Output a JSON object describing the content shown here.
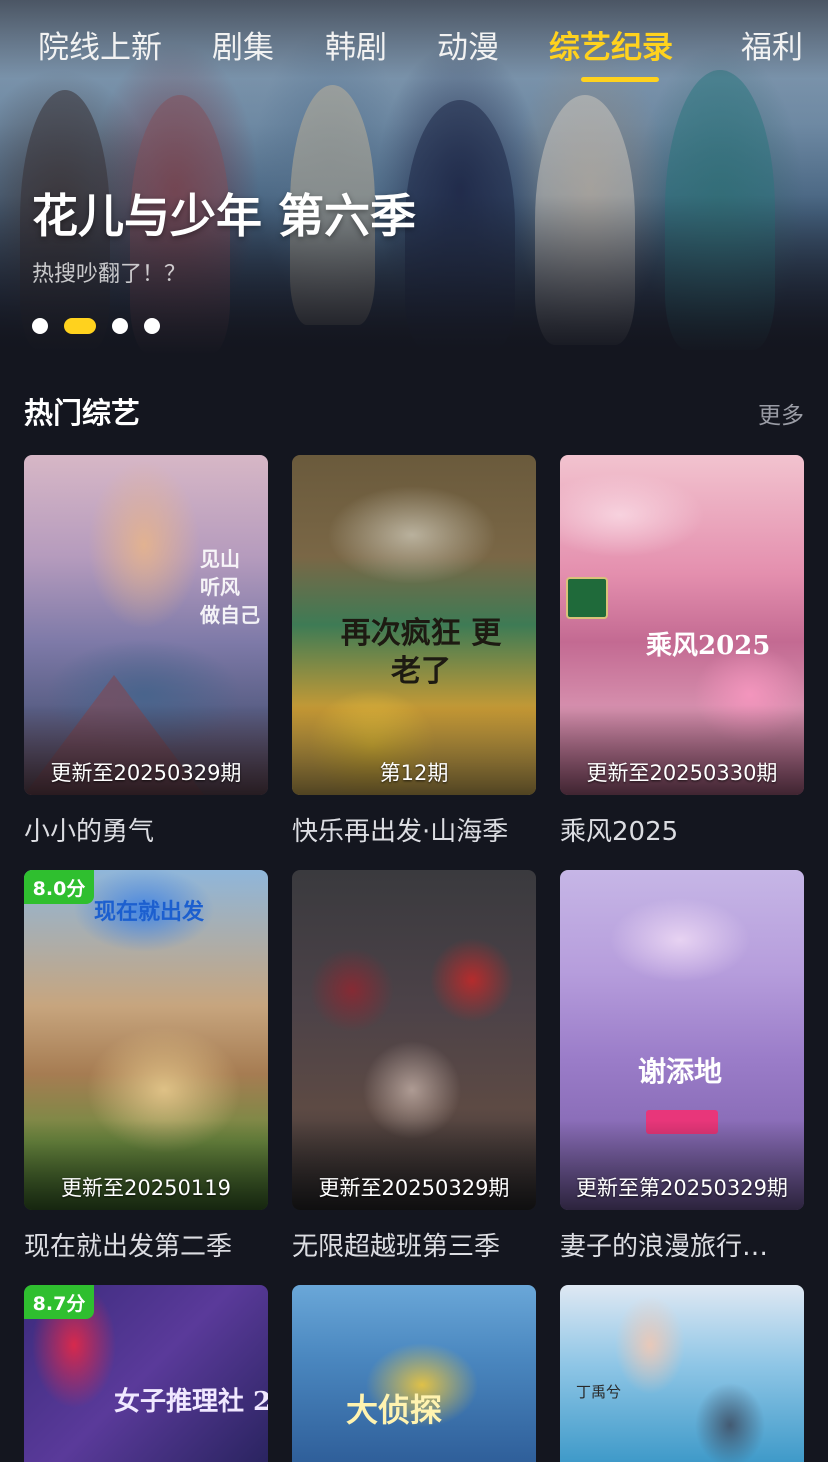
{
  "tabs": [
    {
      "label": "院线上新",
      "active": false
    },
    {
      "label": "剧集",
      "active": false
    },
    {
      "label": "韩剧",
      "active": false
    },
    {
      "label": "动漫",
      "active": false
    },
    {
      "label": "综艺纪录",
      "active": true
    },
    {
      "label": "福利",
      "active": false
    }
  ],
  "hero": {
    "title": "花儿与少年 第六季",
    "subtitle": "热搜吵翻了！？",
    "slide_count": 4,
    "active_slide": 2
  },
  "section": {
    "title": "热门综艺",
    "more_label": "更多"
  },
  "cards": [
    {
      "title": "小小的勇气",
      "update": "更新至20250329期",
      "score": "",
      "poster_text": "见山 听风 做自己"
    },
    {
      "title": "快乐再出发·山海季",
      "update": "第12期",
      "score": "",
      "poster_text": "再次疯狂 更老了"
    },
    {
      "title": "乘风2025",
      "update": "更新至20250330期",
      "score": "",
      "poster_text": "乘风2025"
    },
    {
      "title": "现在就出发第二季",
      "update": "更新至20250119",
      "score": "8.0分",
      "poster_text": "现在就出发"
    },
    {
      "title": "无限超越班第三季",
      "update": "更新至20250329期",
      "score": "",
      "poster_text": ""
    },
    {
      "title": "妻子的浪漫旅行…",
      "update": "更新至第20250329期",
      "score": "",
      "poster_text": "谢添地"
    },
    {
      "title": "",
      "update": "",
      "score": "8.7分",
      "poster_text": "女子推理社 2"
    },
    {
      "title": "",
      "update": "",
      "score": "",
      "poster_text": "大侦探"
    },
    {
      "title": "",
      "update": "",
      "score": "",
      "poster_text": "丁禹兮"
    }
  ],
  "colors": {
    "accent": "#ffd21e",
    "score_badge": "#2fbf2f",
    "background": "#14161f"
  }
}
